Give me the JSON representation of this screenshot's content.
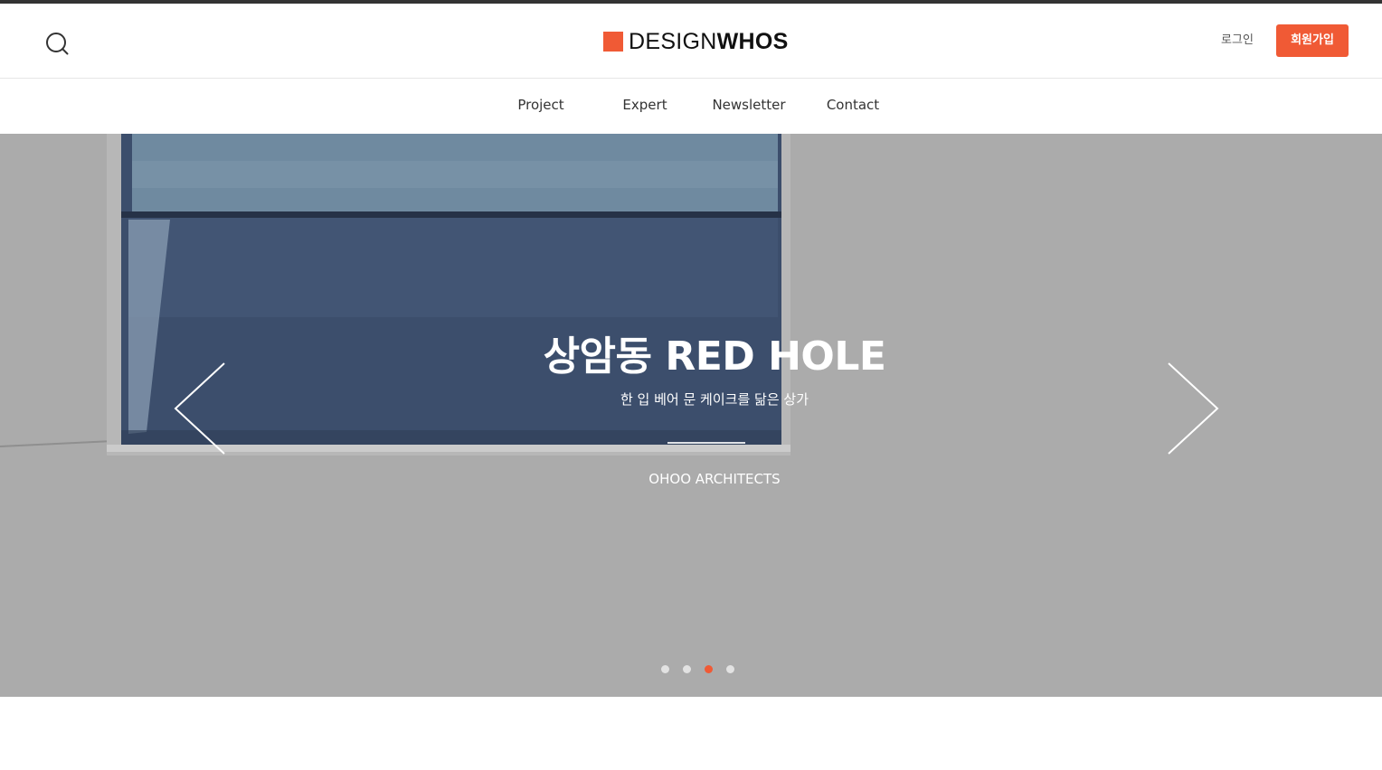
{
  "header": {
    "logo": {
      "part_light": "DESIGN",
      "part_bold": "WHOS",
      "icon": "orange-square-logo-mark"
    },
    "search_icon": "search-icon",
    "login_label": "로그인",
    "signup_label": "회원가입"
  },
  "nav": {
    "items": [
      {
        "label": "Project"
      },
      {
        "label": "Expert"
      },
      {
        "label": "Newsletter"
      },
      {
        "label": "Contact"
      }
    ]
  },
  "hero": {
    "title": "상암동 RED HOLE",
    "subtitle": "한 입 베어 문 케이크를 닮은 상가",
    "firm": "OHOO ARCHITECTS",
    "prev_icon": "chevron-left-icon",
    "next_icon": "chevron-right-icon",
    "slide_count": 4,
    "active_slide_index": 2
  },
  "colors": {
    "accent": "#f05a35",
    "top_strip": "#333333",
    "hero_overlay": "#a9a9a9",
    "dot_inactive": "#e2e2e2"
  }
}
